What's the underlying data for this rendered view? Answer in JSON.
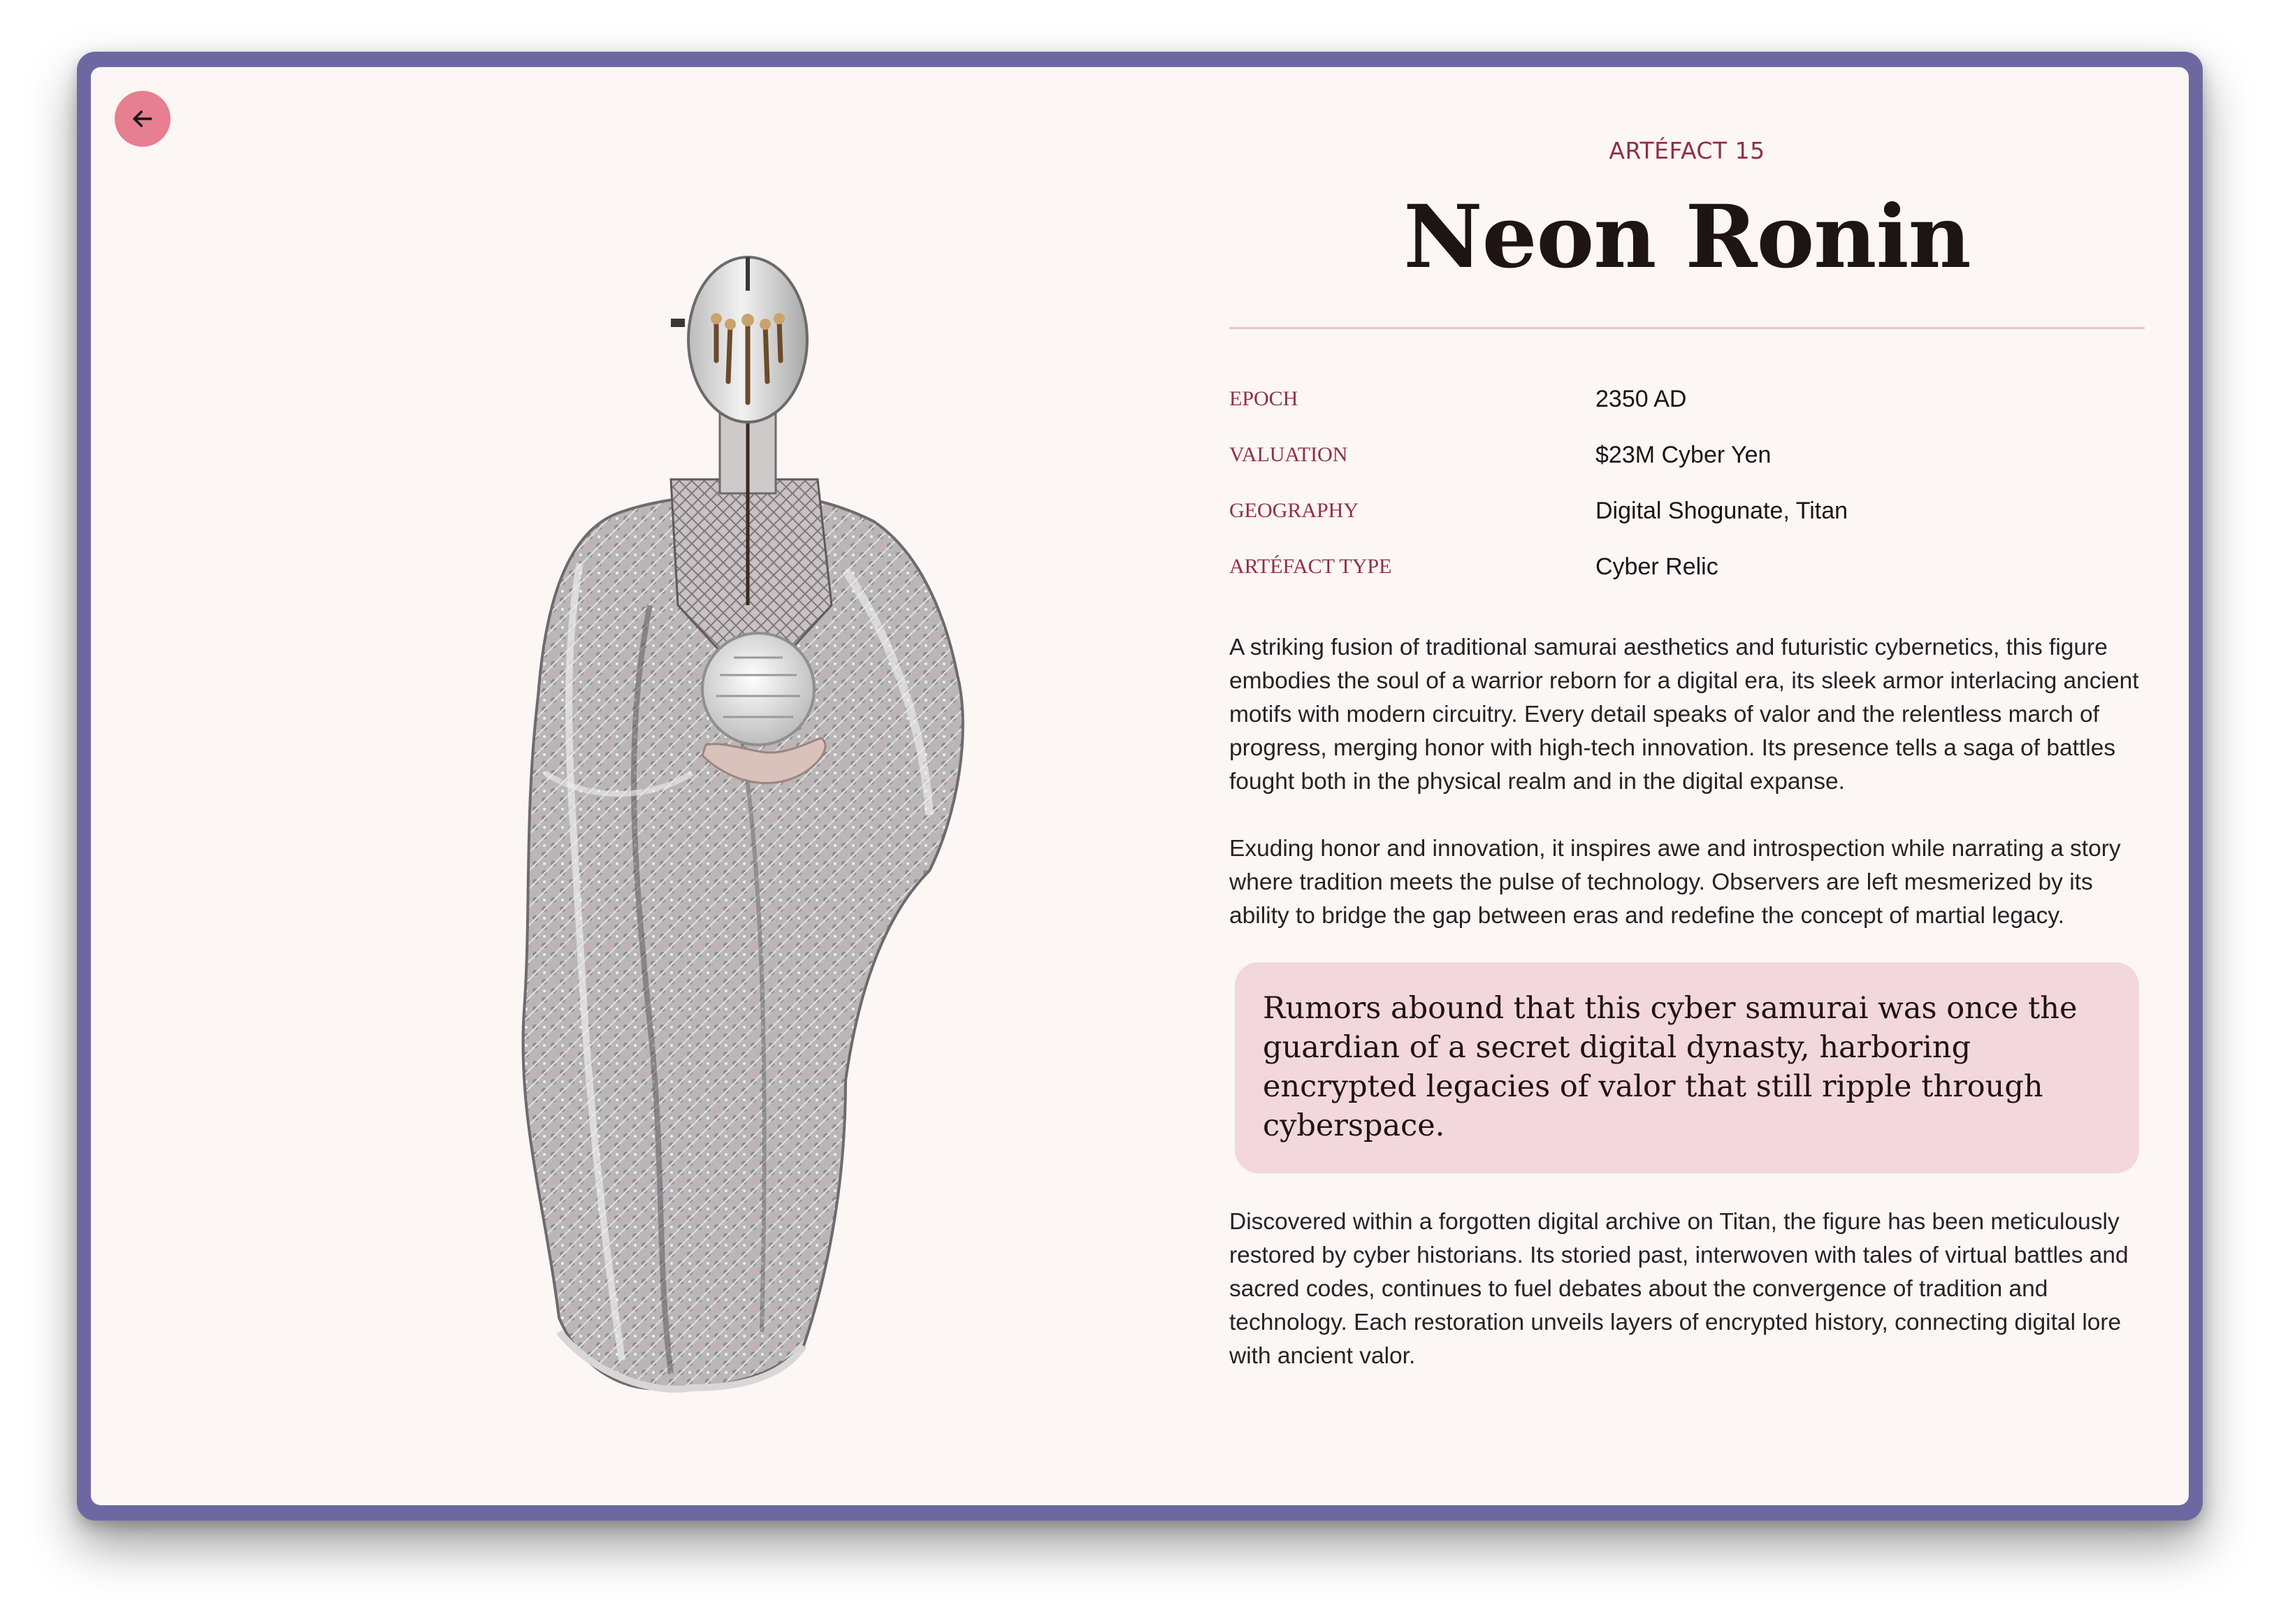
{
  "navigation": {
    "back_icon": "arrow-left-icon"
  },
  "artefact": {
    "eyebrow": "ARTÉFACT 15",
    "title": "Neon Ronin",
    "details": [
      {
        "label": "EPOCH",
        "value": "2350 AD"
      },
      {
        "label": "VALUATION",
        "value": "$23M Cyber Yen"
      },
      {
        "label": "GEOGRAPHY",
        "value": "Digital Shogunate, Titan"
      },
      {
        "label": "ARTÉFACT TYPE",
        "value": "Cyber Relic"
      }
    ],
    "description_1": "A striking fusion of traditional samurai aesthetics and futuristic cybernetics, this figure embodies the soul of a warrior reborn for a digital era, its sleek armor interlacing ancient motifs with modern circuitry. Every detail speaks of valor and the relentless march of progress, merging honor with high-tech innovation. Its presence tells a saga of battles fought both in the physical realm and in the digital expanse.",
    "description_2": "Exuding honor and innovation, it inspires awe and introspection while narrating a story where tradition meets the pulse of technology. Observers are left mesmerized by its ability to bridge the gap between eras and redefine the concept of martial legacy.",
    "quote": "Rumors abound that this cyber samurai was once the guardian of a secret digital dynasty, harboring encrypted legacies of valor that still ripple through cyberspace.",
    "description_3": "Discovered within a forgotten digital archive on Titan, the figure has been meticulously restored by cyber historians. Its storied past, interwoven with tales of virtual battles and sacred codes, continues to fuel debates about the convergence of tradition and technology. Each restoration unveils layers of encrypted history, connecting digital lore with ancient valor."
  },
  "colors": {
    "frame": "#6e68a2",
    "card": "#fcf6f5",
    "accent": "#8e3049",
    "back_button": "#e77f90",
    "quote_background": "#f2d7dc"
  }
}
